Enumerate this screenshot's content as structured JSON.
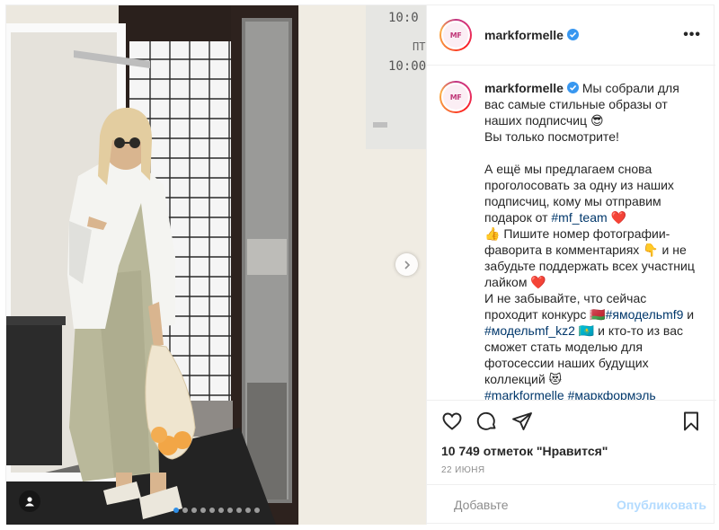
{
  "post": {
    "username": "markformelle",
    "avatar_text": "MF",
    "more_label": "•••",
    "caption": {
      "segments": [
        {
          "text": "Мы собрали для вас самые стильные образы от наших подписчиц 😎\nВы только посмотрите!\n\nА ещё мы предлагаем снова проголосовать за одну из наших подписчиц, кому мы отправим подарок от ",
          "tag": false
        },
        {
          "text": "#mf_team",
          "tag": true
        },
        {
          "text": " ❤️\n👍 Пишите номер фотографии-фаворита в комментариях 👇 и не забудьте поддержать всех участниц лайком ❤️\nИ не забывайте, что сейчас проходит конкурс 🇧🇾",
          "tag": false
        },
        {
          "text": "#ямодельmf9",
          "tag": true
        },
        {
          "text": " и\n",
          "tag": false
        },
        {
          "text": "#модельmf_kz2",
          "tag": true
        },
        {
          "text": " 🇰🇿 и кто-то из вас сможет стать моделью для фотосессии наших будущих коллекций 😻\n",
          "tag": false
        },
        {
          "text": "#markformelle",
          "tag": true
        },
        {
          "text": " ",
          "tag": false
        },
        {
          "text": "#маркформэль",
          "tag": true
        }
      ]
    },
    "likes": "10 749 отметок \"Нравится\"",
    "date": "22 июня",
    "comment_placeholder": "Добавьте",
    "publish_label": "Опубликовать",
    "carousel": {
      "count": 10,
      "active_index": 0
    },
    "icons": [
      "heart-icon",
      "comment-icon",
      "share-icon",
      "bookmark-icon",
      "emoji-icon",
      "chevron-right-icon",
      "user-tag-icon",
      "verified-icon"
    ],
    "colors": {
      "link": "#00376b",
      "verified": "#3897f0",
      "publish_disabled": "#b3dbff",
      "active_dot": "#2f8ee6"
    },
    "photo_sign_text": [
      "10:0",
      "ПТ",
      "10:00"
    ]
  }
}
